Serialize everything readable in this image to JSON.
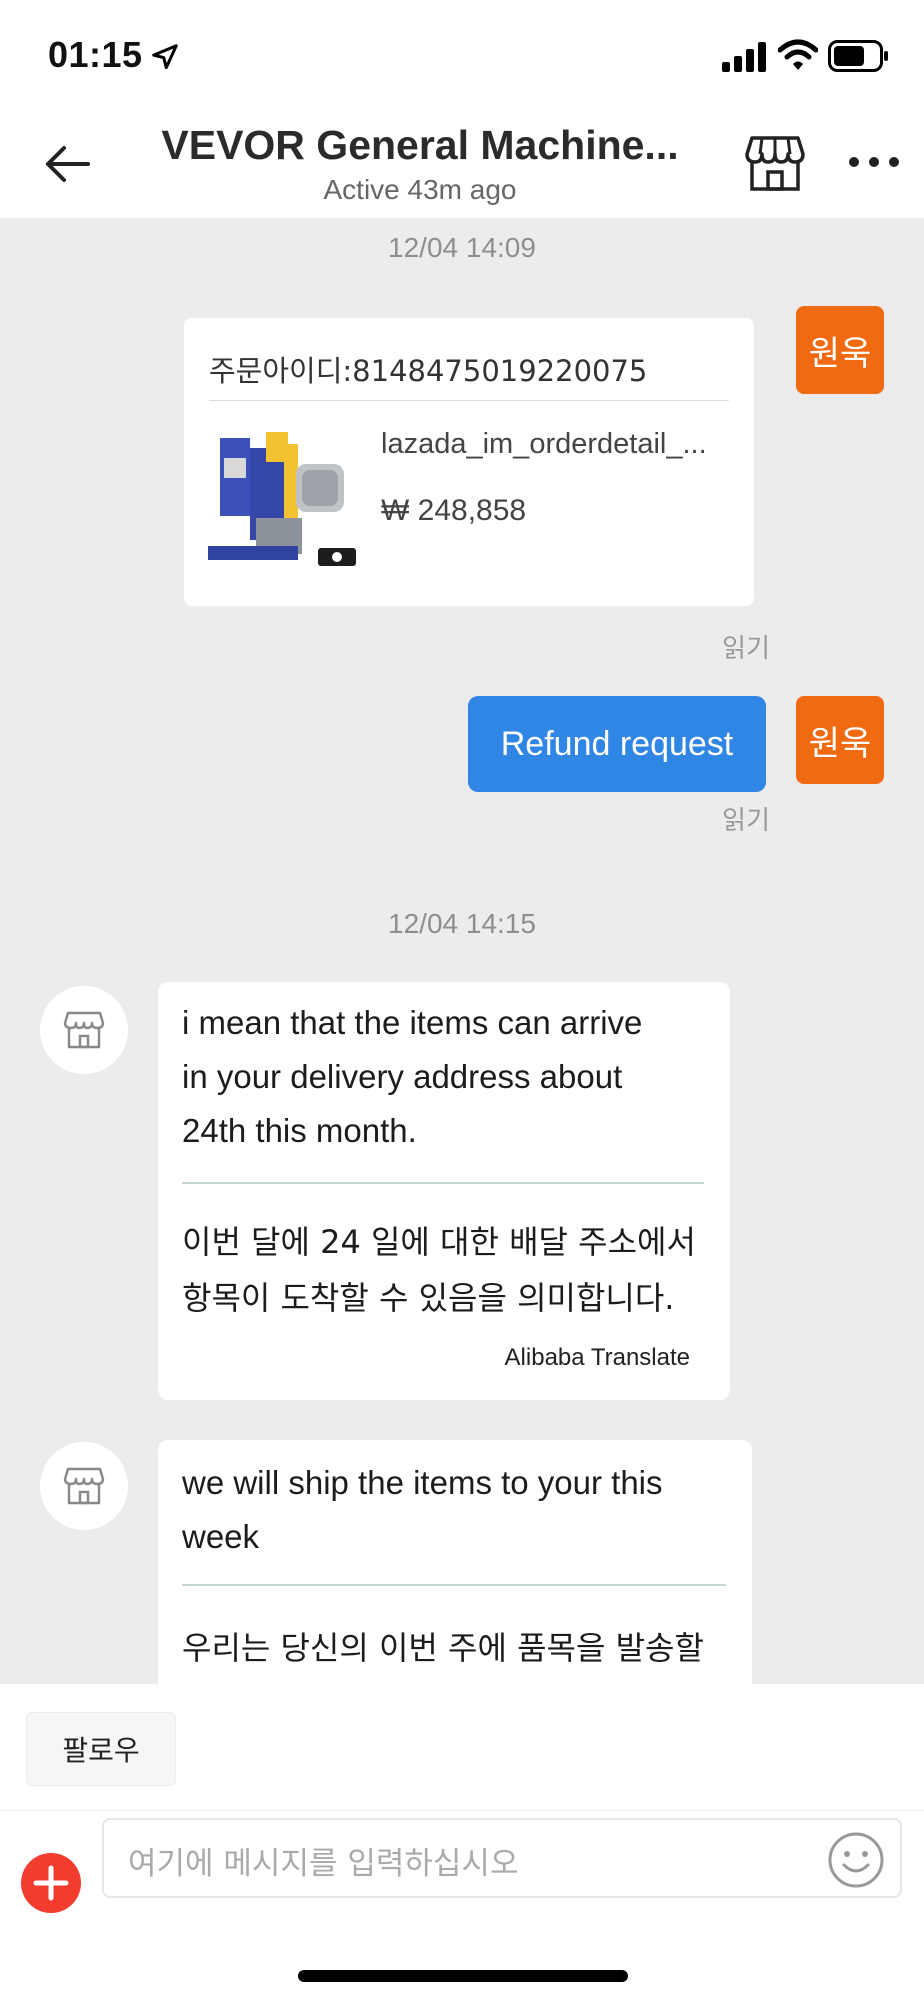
{
  "status_bar": {
    "time": "01:15",
    "icons": [
      "location-arrow-icon",
      "signal-icon",
      "wifi-icon",
      "battery-icon"
    ]
  },
  "header": {
    "title": "VEVOR General Machine...",
    "subtitle": "Active 43m ago",
    "icons": [
      "back-arrow-icon",
      "store-icon",
      "more-icon"
    ]
  },
  "chat": {
    "timestamps": [
      "12/04 14:09",
      "12/04 14:15"
    ],
    "my_avatar_label": "원욱",
    "order_card": {
      "order_id": "주문아이디:8148475019220075",
      "product_name": "lazada_im_orderdetail_...",
      "price": "₩ 248,858"
    },
    "read_label": "읽기",
    "refund_message": "Refund request",
    "seller_messages": [
      {
        "lines": [
          "i mean that the items can arrive",
          "in your delivery address about",
          "24th this month."
        ],
        "translation_lines": [
          "이번 달에 24 일에 대한 배달 주소에서",
          "항목이 도착할 수 있음을 의미합니다."
        ],
        "credit": "Alibaba Translate"
      },
      {
        "lines": [
          "we will ship the items to your this",
          "week"
        ],
        "translation_lines": [
          "우리는 당신의 이번 주에 품목을 발송할"
        ]
      }
    ]
  },
  "footer": {
    "follow_label": "팔로우",
    "message_placeholder": "여기에 메시지를 입력하십시오",
    "icons": [
      "add-icon",
      "emoji-icon"
    ]
  },
  "colors": {
    "chat_background": "#ececec",
    "my_avatar": "#f06a12",
    "my_bubble": "#2f86e4",
    "add_button": "#f23c2e"
  }
}
